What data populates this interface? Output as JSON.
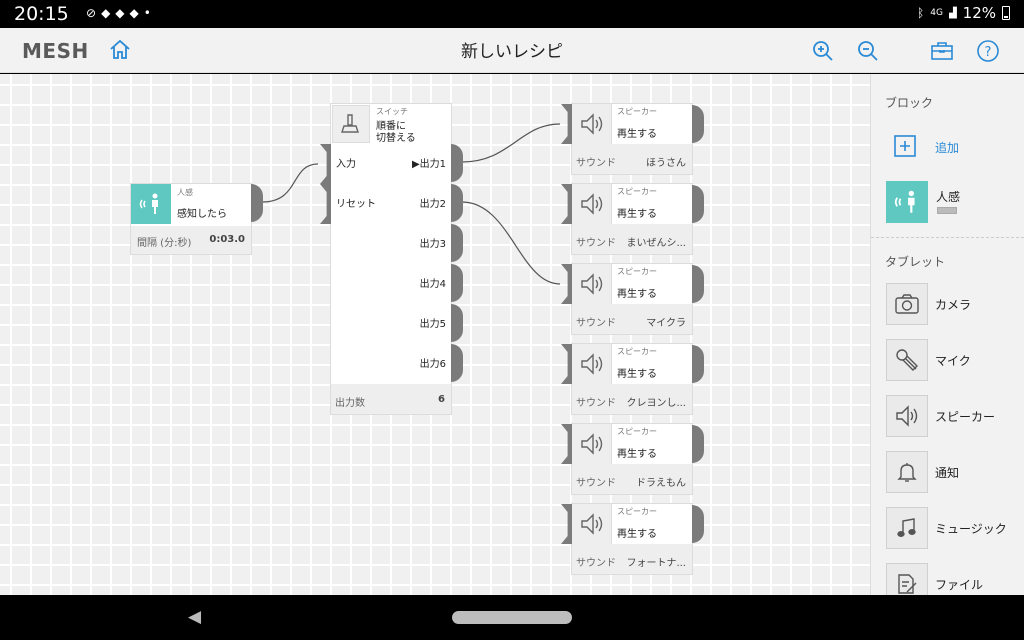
{
  "status": {
    "time": "20:15",
    "network": "4G",
    "battery": "12%"
  },
  "app": {
    "logo": "MESH",
    "title": "新しいレシピ"
  },
  "human_node": {
    "category": "人感",
    "action": "感知したら",
    "param_label": "間隔 (分:秒)",
    "param_value": "0:03.0"
  },
  "switch_node": {
    "category": "スイッチ",
    "action_line1": "順番に",
    "action_line2": "切替える",
    "input_label": "入力",
    "reset_label": "リセット",
    "outputs": [
      "▶出力1",
      "出力2",
      "出力3",
      "出力4",
      "出力5",
      "出力6"
    ],
    "footer_label": "出力数",
    "footer_value": "6"
  },
  "speakers": [
    {
      "category": "スピーカー",
      "action": "再生する",
      "sound_label": "サウンド",
      "sound_value": "ほうさん"
    },
    {
      "category": "スピーカー",
      "action": "再生する",
      "sound_label": "サウンド",
      "sound_value": "まいぜんシ..."
    },
    {
      "category": "スピーカー",
      "action": "再生する",
      "sound_label": "サウンド",
      "sound_value": "マイクラ"
    },
    {
      "category": "スピーカー",
      "action": "再生する",
      "sound_label": "サウンド",
      "sound_value": "クレヨンし..."
    },
    {
      "category": "スピーカー",
      "action": "再生する",
      "sound_label": "サウンド",
      "sound_value": "ドラえもん"
    },
    {
      "category": "スピーカー",
      "action": "再生する",
      "sound_label": "サウンド",
      "sound_value": "フォートナ..."
    }
  ],
  "sidebar": {
    "blocks_heading": "ブロック",
    "add_label": "追加",
    "block_item": "人感",
    "tablet_heading": "タブレット",
    "tablet_items": [
      "カメラ",
      "マイク",
      "スピーカー",
      "通知",
      "ミュージック",
      "ファイル"
    ]
  },
  "colors": {
    "accent": "#2a8ad6",
    "human_block": "#5fc8c0",
    "port": "#7b7b7b"
  }
}
